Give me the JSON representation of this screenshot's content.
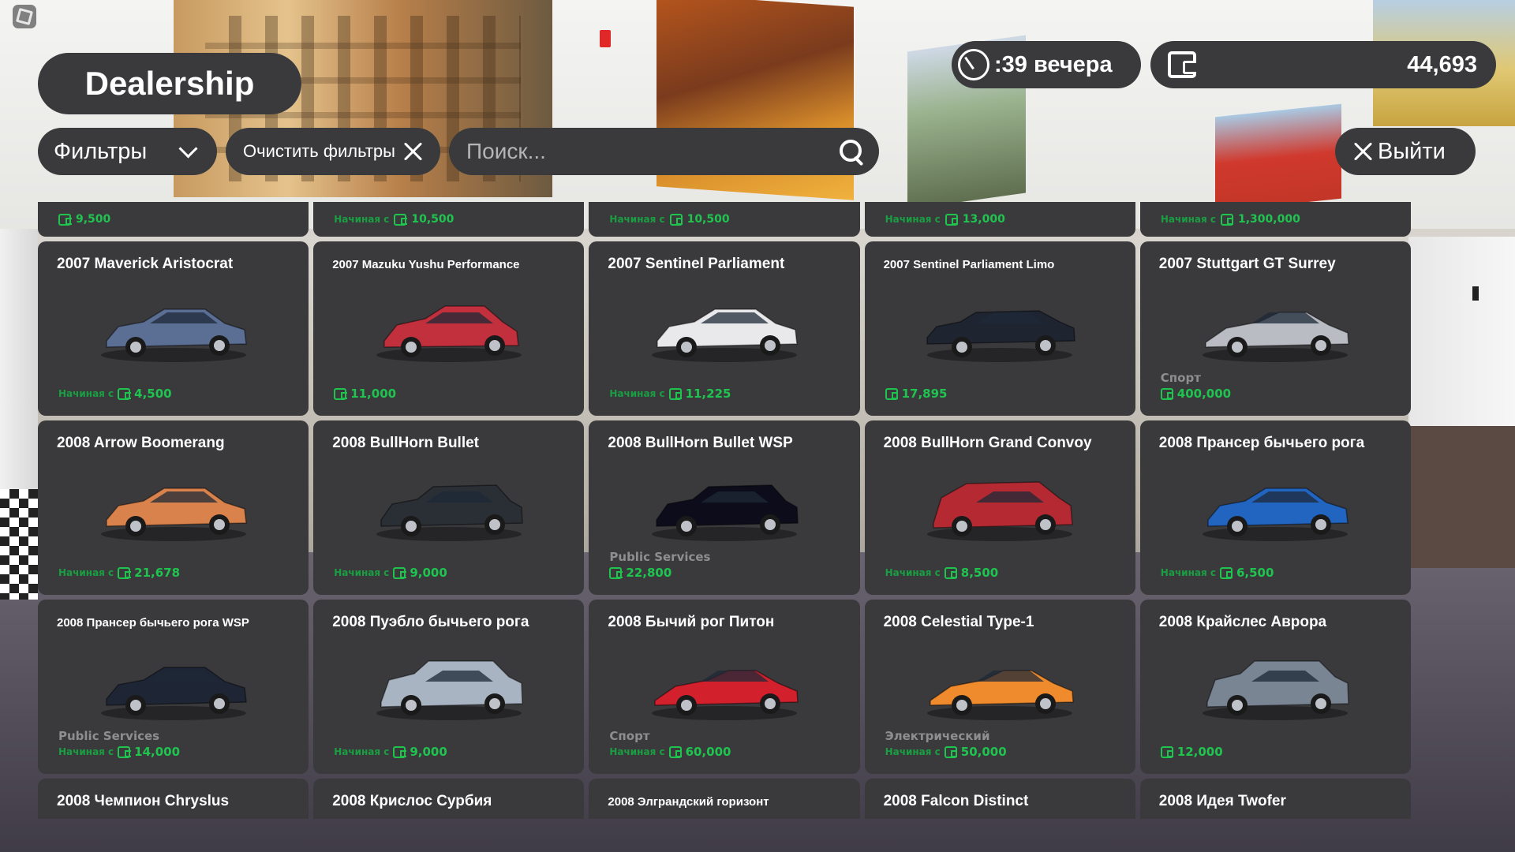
{
  "header": {
    "title": "Dealership",
    "filters_label": "Фильтры",
    "clear_filters_label": "Очистить фильтры",
    "search_placeholder": "Поиск...",
    "time": ":39 вечера",
    "balance": "44,693",
    "exit_label": "Выйти"
  },
  "price_prefix": "Начиная с",
  "top_strip": [
    {
      "prefix": "",
      "price": "9,500"
    },
    {
      "prefix": "Начиная с",
      "price": "10,500"
    },
    {
      "prefix": "Начиная с",
      "price": "10,500"
    },
    {
      "prefix": "Начиная с",
      "price": "13,000"
    },
    {
      "prefix": "Начиная с",
      "price": "1,300,000"
    }
  ],
  "cars": [
    {
      "name": "2007 Maverick Aristocrat",
      "category": "",
      "prefix": "Начиная с",
      "price": "4,500",
      "color": "#5b6e93",
      "shape": "sedan"
    },
    {
      "name": "2007 Mazuku Yushu Performance",
      "category": "",
      "prefix": "",
      "price": "11,000",
      "color": "#c2303d",
      "shape": "hatch"
    },
    {
      "name": "2007 Sentinel Parliament",
      "category": "",
      "prefix": "Начиная с",
      "price": "11,225",
      "color": "#e9e9ec",
      "shape": "sedan"
    },
    {
      "name": "2007 Sentinel Parliament Limo",
      "category": "",
      "prefix": "",
      "price": "17,895",
      "color": "#1e2430",
      "shape": "limo"
    },
    {
      "name": "2007 Stuttgart GT Surrey",
      "category": "Спорт",
      "prefix": "",
      "price": "400,000",
      "color": "#b9bcc2",
      "shape": "sport"
    },
    {
      "name": "2008 Arrow Boomerang",
      "category": "",
      "prefix": "Начиная с",
      "price": "21,678",
      "color": "#d9824b",
      "shape": "sedan"
    },
    {
      "name": "2008 BullHorn Bullet",
      "category": "",
      "prefix": "Начиная с",
      "price": "9,000",
      "color": "#2a2f36",
      "shape": "wagon"
    },
    {
      "name": "2008 BullHorn Bullet WSP",
      "category": "Public Services",
      "prefix": "",
      "price": "22,800",
      "color": "#0c0c1a",
      "shape": "wagon"
    },
    {
      "name": "2008 BullHorn Grand Convoy",
      "category": "",
      "prefix": "Начиная с",
      "price": "8,500",
      "color": "#b52a32",
      "shape": "van"
    },
    {
      "name": "2008 Прансер бычьего рога",
      "category": "",
      "prefix": "Начиная с",
      "price": "6,500",
      "color": "#2165c1",
      "shape": "sedan"
    },
    {
      "name": "2008 Прансер бычьего рога WSP",
      "category": "Public Services",
      "prefix": "Начиная с",
      "price": "14,000",
      "color": "#1e2635",
      "shape": "sedan"
    },
    {
      "name": "2008 Пуэбло бычьего рога",
      "category": "",
      "prefix": "Начиная с",
      "price": "9,000",
      "color": "#a8b4c2",
      "shape": "suv"
    },
    {
      "name": "2008 Бычий рог Питон",
      "category": "Спорт",
      "prefix": "Начиная с",
      "price": "60,000",
      "color": "#d2202c",
      "shape": "sport"
    },
    {
      "name": "2008 Celestial Type-1",
      "category": "Электрический",
      "prefix": "Начиная с",
      "price": "50,000",
      "color": "#ef8b2d",
      "shape": "sport"
    },
    {
      "name": "2008 Крайслес Аврора",
      "category": "",
      "prefix": "",
      "price": "12,000",
      "color": "#7a8594",
      "shape": "suv"
    }
  ],
  "bottom_row": [
    {
      "name": "2008 Чемпион Chryslus"
    },
    {
      "name": "2008 Крислос Сурбия"
    },
    {
      "name": "2008 Элграндский горизонт"
    },
    {
      "name": "2008 Falcon Distinct"
    },
    {
      "name": "2008 Идея Twofer"
    }
  ]
}
